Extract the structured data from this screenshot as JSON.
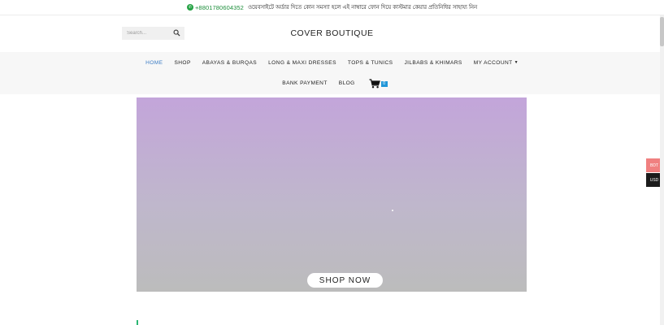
{
  "topbar": {
    "phone": "+8801780604352",
    "notice": "ওয়েবসাইটে অর্ডার দিতে কোন সমস্যা হলে এই নাম্বারে ফোন দিয়ে কাস্টমার কেয়ার প্রতিনিধির সাহায্য নিন",
    "icon": "whatsapp-icon"
  },
  "header": {
    "search_placeholder": "Search...",
    "brand": "COVER BOUTIQUE"
  },
  "nav": {
    "row1": [
      {
        "label": "HOME",
        "active": true
      },
      {
        "label": "SHOP"
      },
      {
        "label": "ABAYAS & BURQAS"
      },
      {
        "label": "LONG & MAXI DRESSES"
      },
      {
        "label": "TOPS & TUNICS"
      },
      {
        "label": "JILBABS & KHIMARS"
      },
      {
        "label": "MY ACCOUNT",
        "dropdown": true
      }
    ],
    "row2": [
      {
        "label": "BANK PAYMENT"
      },
      {
        "label": "BLOG"
      }
    ],
    "cart_count": "0"
  },
  "hero": {
    "button_label": "SHOP NOW"
  },
  "currency": {
    "bdt": "BDT",
    "usd": "USD"
  },
  "colors": {
    "accent_blue": "#3b7cc4",
    "whatsapp_green": "#1e8f3c",
    "cart_badge": "#2196d8",
    "bdt_bg": "#f08080",
    "usd_bg": "#1b1b1b"
  }
}
